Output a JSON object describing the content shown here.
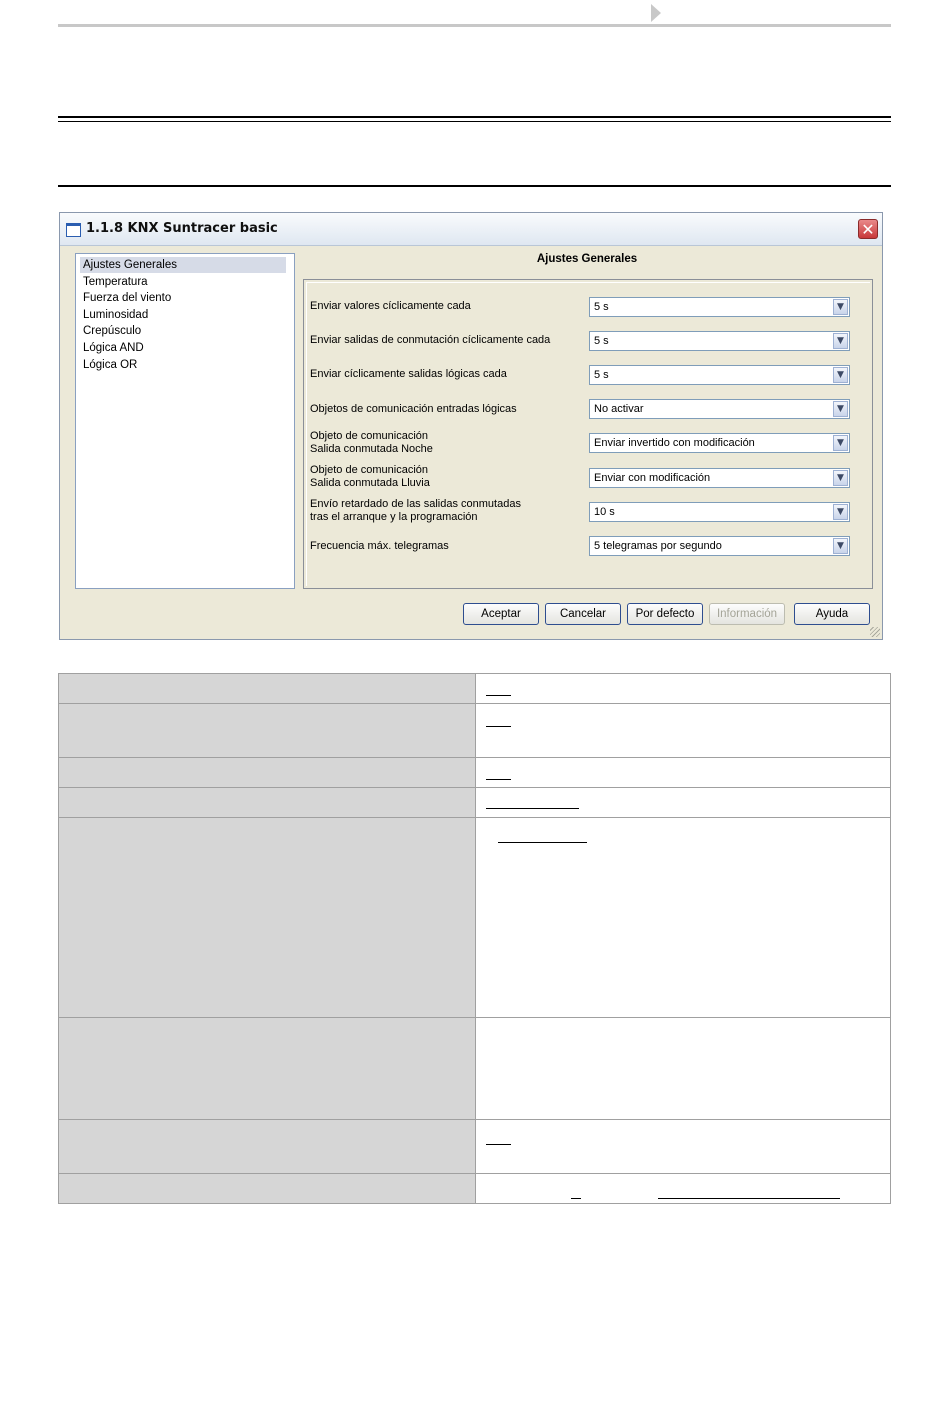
{
  "dialog": {
    "title": "1.1.8 KNX Suntracer basic",
    "close_glyph": "✕",
    "tree_items": [
      "Ajustes Generales",
      "Temperatura",
      "Fuerza del viento",
      "Luminosidad",
      "Crepúsculo",
      "Lógica AND",
      "Lógica OR"
    ],
    "selected_item": "Ajustes Generales",
    "panel_title": "Ajustes Generales",
    "params": [
      {
        "label": "Enviar valores cíclicamente cada",
        "value": "5 s"
      },
      {
        "label": "Enviar salidas de conmutación cíclicamente cada",
        "value": "5 s"
      },
      {
        "label": "Enviar cíclicamente salidas lógicas cada",
        "value": "5 s"
      },
      {
        "label": "Objetos de comunicación entradas lógicas",
        "value": "No activar"
      },
      {
        "label_line1": "Objeto de comunicación",
        "label_line2": "Salida conmutada Noche",
        "value": "Enviar invertido con modificación"
      },
      {
        "label_line1": "Objeto de comunicación",
        "label_line2": "Salida conmutada Lluvia",
        "value": "Enviar con modificación"
      },
      {
        "label_line1": "Envío retardado de las salidas conmutadas",
        "label_line2": "tras el arranque y la programación",
        "value": "10 s"
      },
      {
        "label": "Frecuencia máx. telegramas",
        "value": "5 telegramas por segundo"
      }
    ],
    "buttons": {
      "ok": "Aceptar",
      "cancel": "Cancelar",
      "default": "Por defecto",
      "info": "Información",
      "help": "Ayuda"
    },
    "dropdown_glyph": "▼"
  },
  "colors": {
    "dialog_bg": "#ece9d8",
    "table_label_bg": "#d6d6d6",
    "close_button": "#c8383a"
  },
  "icons": [
    "window-icon",
    "close-icon",
    "chevron-down-icon",
    "resize-grip-icon",
    "page-arrow-icon"
  ]
}
